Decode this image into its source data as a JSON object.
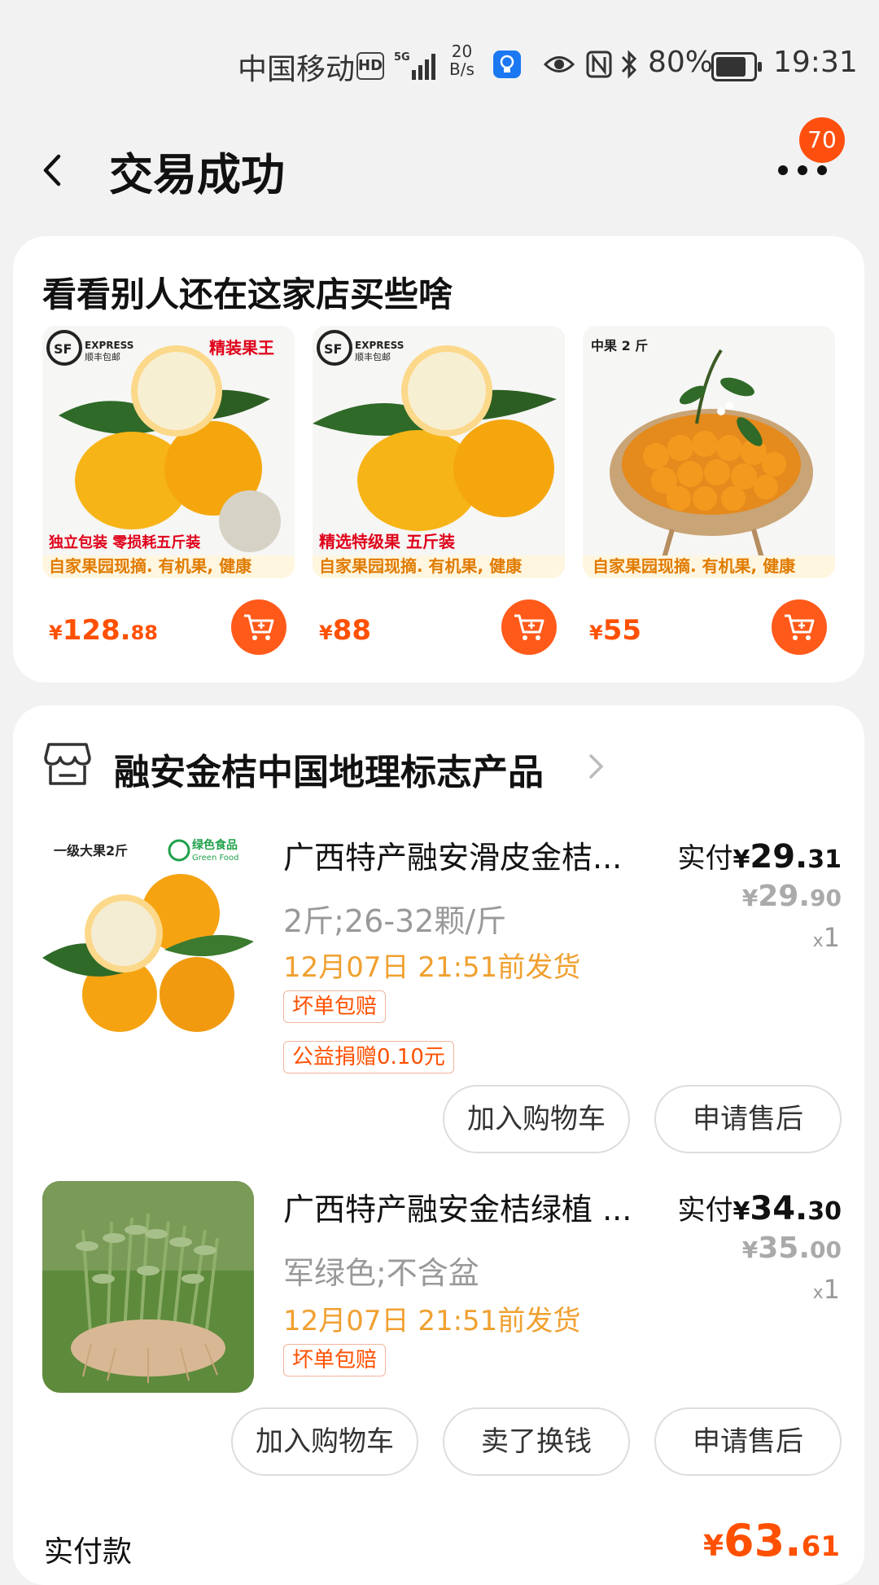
{
  "status_bar": {
    "carrier": "中国移动",
    "hd": "HD",
    "net_speed": "20",
    "net_speed_unit": "B/s",
    "battery": "80%",
    "time": "19:31"
  },
  "header": {
    "title": "交易成功",
    "badge_count": "70"
  },
  "recommend": {
    "title": "看看别人还在这家店买些啥",
    "items": [
      {
        "price_currency": "¥",
        "price_int": "128.",
        "price_dec": "88",
        "img_text_top": "精装果王",
        "img_text_mid": "独立包装 零损耗五斤装",
        "img_text_bottom": "自家果园现摘. 有机果, 健康",
        "brand": "EXPRESS",
        "brand_sub": "顺丰包邮"
      },
      {
        "price_currency": "¥",
        "price_int": "88",
        "price_dec": "",
        "img_text_top": "",
        "img_text_mid": "精选特级果 五斤装",
        "img_text_bottom": "自家果园现摘. 有机果, 健康",
        "brand": "EXPRESS",
        "brand_sub": "顺丰包邮"
      },
      {
        "price_currency": "¥",
        "price_int": "55",
        "price_dec": "",
        "img_text_top": "中果 2 斤",
        "img_text_mid": "",
        "img_text_bottom": "自家果园现摘. 有机果, 健康",
        "brand": "",
        "brand_sub": ""
      }
    ]
  },
  "order": {
    "store_name": "融安金桔中国地理标志产品",
    "items": [
      {
        "title": "广西特产融安滑皮金桔...",
        "sku": "2斤;26-32颗/斤",
        "ship": "12月07日 21:51前发货",
        "tags": [
          "坏单包赔",
          "公益捐赠0.10元"
        ],
        "paid_label": "实付",
        "paid_cur": "¥",
        "paid_int": "29.",
        "paid_dec": "31",
        "orig_cur": "¥",
        "orig_int": "29.",
        "orig_dec": "90",
        "qty_x": "x",
        "qty": "1",
        "img_text_left": "一级大果2斤",
        "img_text_right": "绿色食品",
        "img_text_right_sub": "Green Food",
        "buttons": [
          "加入购物车",
          "申请售后"
        ]
      },
      {
        "title": "广西特产融安金桔绿植 ...",
        "sku": "军绿色;不含盆",
        "ship": "12月07日 21:51前发货",
        "tags": [
          "坏单包赔"
        ],
        "paid_label": "实付",
        "paid_cur": "¥",
        "paid_int": "34.",
        "paid_dec": "30",
        "orig_cur": "¥",
        "orig_int": "35.",
        "orig_dec": "00",
        "qty_x": "x",
        "qty": "1",
        "buttons": [
          "加入购物车",
          "卖了换钱",
          "申请售后"
        ]
      }
    ],
    "total_label": "实付款",
    "total_cur": "¥",
    "total_int": "63.",
    "total_dec": "61"
  },
  "colors": {
    "accent": "#ff5000",
    "ship": "#f0a030",
    "badge": "#ff4f0f"
  }
}
